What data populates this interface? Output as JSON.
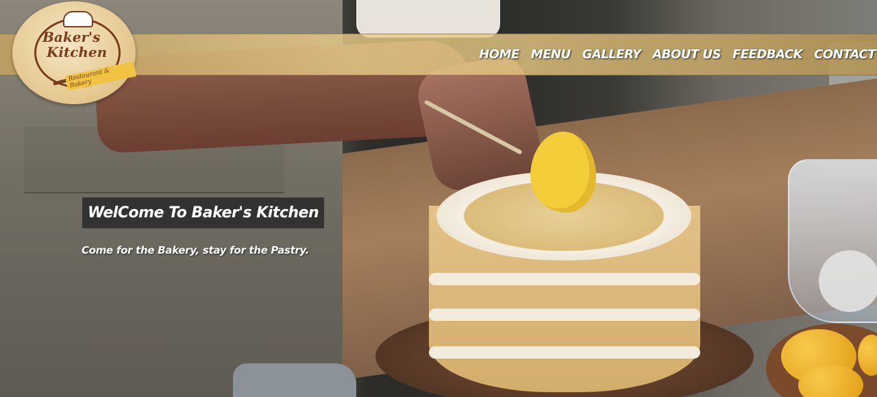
{
  "brand": {
    "logo_line1": "Baker's",
    "logo_line2": "Kitchen",
    "logo_sub": "Restaurant & Bakery"
  },
  "nav": {
    "items": [
      {
        "label": "HOME"
      },
      {
        "label": "MENU"
      },
      {
        "label": "GALLERY"
      },
      {
        "label": "ABOUT US"
      },
      {
        "label": "FEEDBACK"
      },
      {
        "label": "CONTACT"
      }
    ]
  },
  "hero": {
    "title": "WelCome To Baker's Kitchen",
    "tagline": "Come for the Bakery, stay for the Pastry."
  },
  "colors": {
    "nav_bar": "#e0c27e",
    "logo_brown": "#7a3d1d",
    "title_bg": "#282828",
    "text": "#ffffff"
  }
}
